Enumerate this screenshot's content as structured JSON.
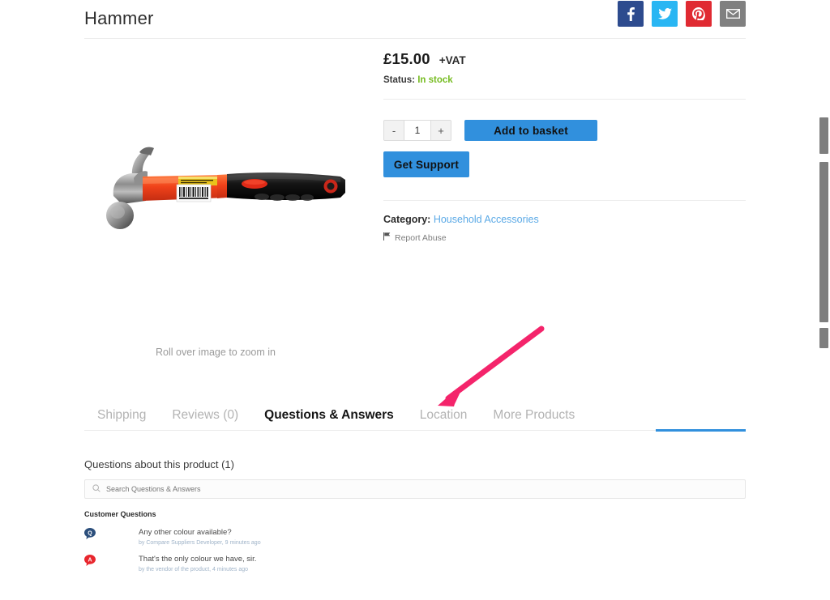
{
  "header": {
    "product_title": "Hammer",
    "share_buttons": [
      {
        "name": "facebook",
        "label": "f",
        "color": "#2d4b8e"
      },
      {
        "name": "twitter",
        "label": "",
        "color": "#29b6f3"
      },
      {
        "name": "pinterest",
        "label": "",
        "color": "#e02a32"
      },
      {
        "name": "email",
        "label": "",
        "color": "#808080"
      }
    ]
  },
  "media": {
    "image_alt": "Claw hammer with orange and black grip",
    "rollover_note": "Roll over image to zoom in"
  },
  "purchase": {
    "price": "£15.00",
    "vat_label": "+VAT",
    "status_label": "Status:",
    "status_value": "In stock",
    "status_color": "#76bc21",
    "quantity": {
      "decrement_label": "-",
      "value": "1",
      "increment_label": "+"
    },
    "add_to_basket_label": "Add to basket",
    "get_support_label": "Get Support",
    "accent_color": "#3190dd",
    "category_label": "Category:",
    "category_value": "Household Accessories",
    "report_abuse_label": "Report Abuse"
  },
  "tabs": [
    {
      "label": "Shipping",
      "active": false
    },
    {
      "label": "Reviews (0)",
      "active": false
    },
    {
      "label": "Questions & Answers",
      "active": true
    },
    {
      "label": "Location",
      "active": false
    },
    {
      "label": "More Products",
      "active": false
    }
  ],
  "qa": {
    "heading": "Questions about this product (1)",
    "search_placeholder": "Search Questions & Answers",
    "search_value": "",
    "subheading": "Customer Questions",
    "items": [
      {
        "badge": "Q",
        "badge_color": "#2c4f7c",
        "text": "Any other colour available?",
        "meta": "by Compare Suppliers Developer, 9 minutes ago"
      },
      {
        "badge": "A",
        "badge_color": "#e8262d",
        "text": "That's the only colour we have, sir.",
        "meta": "by the vendor of the product, 4 minutes ago"
      }
    ]
  },
  "annotation": {
    "arrow_color": "#f4246b",
    "points_to": "Questions & Answers"
  }
}
